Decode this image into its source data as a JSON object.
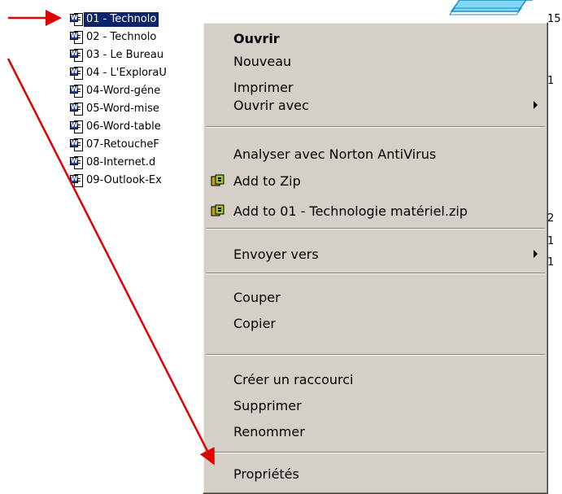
{
  "files": [
    {
      "name": "01 - Technologie matériel.doc",
      "visible": "01 - Technolo",
      "selected": true
    },
    {
      "name": "02 - Technolo",
      "visible": "02 - Technolo",
      "selected": false
    },
    {
      "name": "03 - Le Bureau",
      "visible": "03 - Le Bureau",
      "selected": false
    },
    {
      "name": "04 - L'ExploraU",
      "visible": "04 - L'ExploraU",
      "selected": false
    },
    {
      "name": "04-Word-géne",
      "visible": "04-Word-géne",
      "selected": false
    },
    {
      "name": "05-Word-mise",
      "visible": "05-Word-mise",
      "selected": false
    },
    {
      "name": "06-Word-table",
      "visible": "06-Word-table",
      "selected": false
    },
    {
      "name": "07-RetoucheF",
      "visible": "07-RetoucheF",
      "selected": false
    },
    {
      "name": "08-Internet.d",
      "visible": "08-Internet.d",
      "selected": false
    },
    {
      "name": "09-Outlook-Ex",
      "visible": "09-Outlook-Ex",
      "selected": false
    }
  ],
  "size_column": [
    "15",
    "",
    "1",
    "",
    "",
    "",
    "",
    "2",
    "1",
    "1"
  ],
  "context_menu": {
    "open": "Ouvrir",
    "new": "Nouveau",
    "print": "Imprimer",
    "open_with": "Ouvrir avec",
    "scan_norton": "Analyser avec Norton AntiVirus",
    "add_zip": "Add to Zip",
    "add_to_named_zip": "Add to 01 - Technologie matériel.zip",
    "send_to": "Envoyer vers",
    "cut": "Couper",
    "copy": "Copier",
    "create_shortcut": "Créer un raccourci",
    "delete": "Supprimer",
    "rename": "Renommer",
    "properties": "Propriétés"
  },
  "icons": {
    "file": "word-document-icon",
    "zip": "winzip-icon",
    "submenu": "submenu-arrow-icon"
  },
  "colors": {
    "selection": "#0a246a",
    "menu_bg": "#d4d0c8",
    "annotation_arrow": "#e00000",
    "shape": "#22b8e6"
  }
}
